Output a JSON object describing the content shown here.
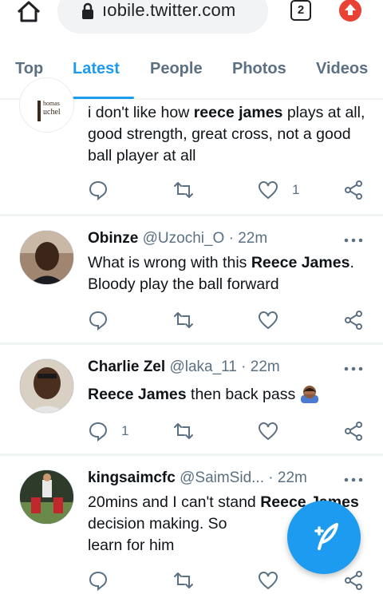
{
  "browser": {
    "url": "ıobile.twitter.com",
    "tab_count": "2",
    "accent": "#e94235"
  },
  "tabs": [
    {
      "label": "Top"
    },
    {
      "label": "Latest"
    },
    {
      "label": "People"
    },
    {
      "label": "Photos"
    },
    {
      "label": "Videos"
    }
  ],
  "active_tab": "Latest",
  "colors": {
    "accent": "#1d9bf0",
    "muted": "#5b7083",
    "text": "#0f1419"
  },
  "tweets": [
    {
      "avatar_logo_text": "homas uchel",
      "body_parts": [
        "i don't like how ",
        "reece james",
        " plays at all, good strength, great cross, not a good ball player at all"
      ],
      "reply_count": "",
      "like_count": "1"
    },
    {
      "name": "Obinze",
      "handle": "@Uzochi_O",
      "time": "· 22m",
      "body_parts": [
        "What is wrong with this ",
        "Reece James",
        ". Bloody play the ball forward"
      ],
      "reply_count": "",
      "like_count": ""
    },
    {
      "name": "Charlie Zel",
      "handle": "@laka_11",
      "time": "· 22m",
      "body_parts": [
        "",
        "Reece James",
        " then back pass "
      ],
      "emoji": "person-facepalming-emoji",
      "reply_count": "1",
      "like_count": ""
    },
    {
      "name": "kingsaimcfc",
      "handle": "@SaimSid...",
      "time": "· 22m",
      "body_parts": [
        "20mins and I can't stand ",
        "Reece James",
        " decision making. So",
        " learn for him"
      ],
      "reply_count": "",
      "like_count": ""
    }
  ],
  "icons": [
    "home-icon",
    "lock-icon",
    "upload-icon",
    "reply-icon",
    "retweet-icon",
    "like-icon",
    "share-icon",
    "more-icon",
    "compose-icon"
  ]
}
